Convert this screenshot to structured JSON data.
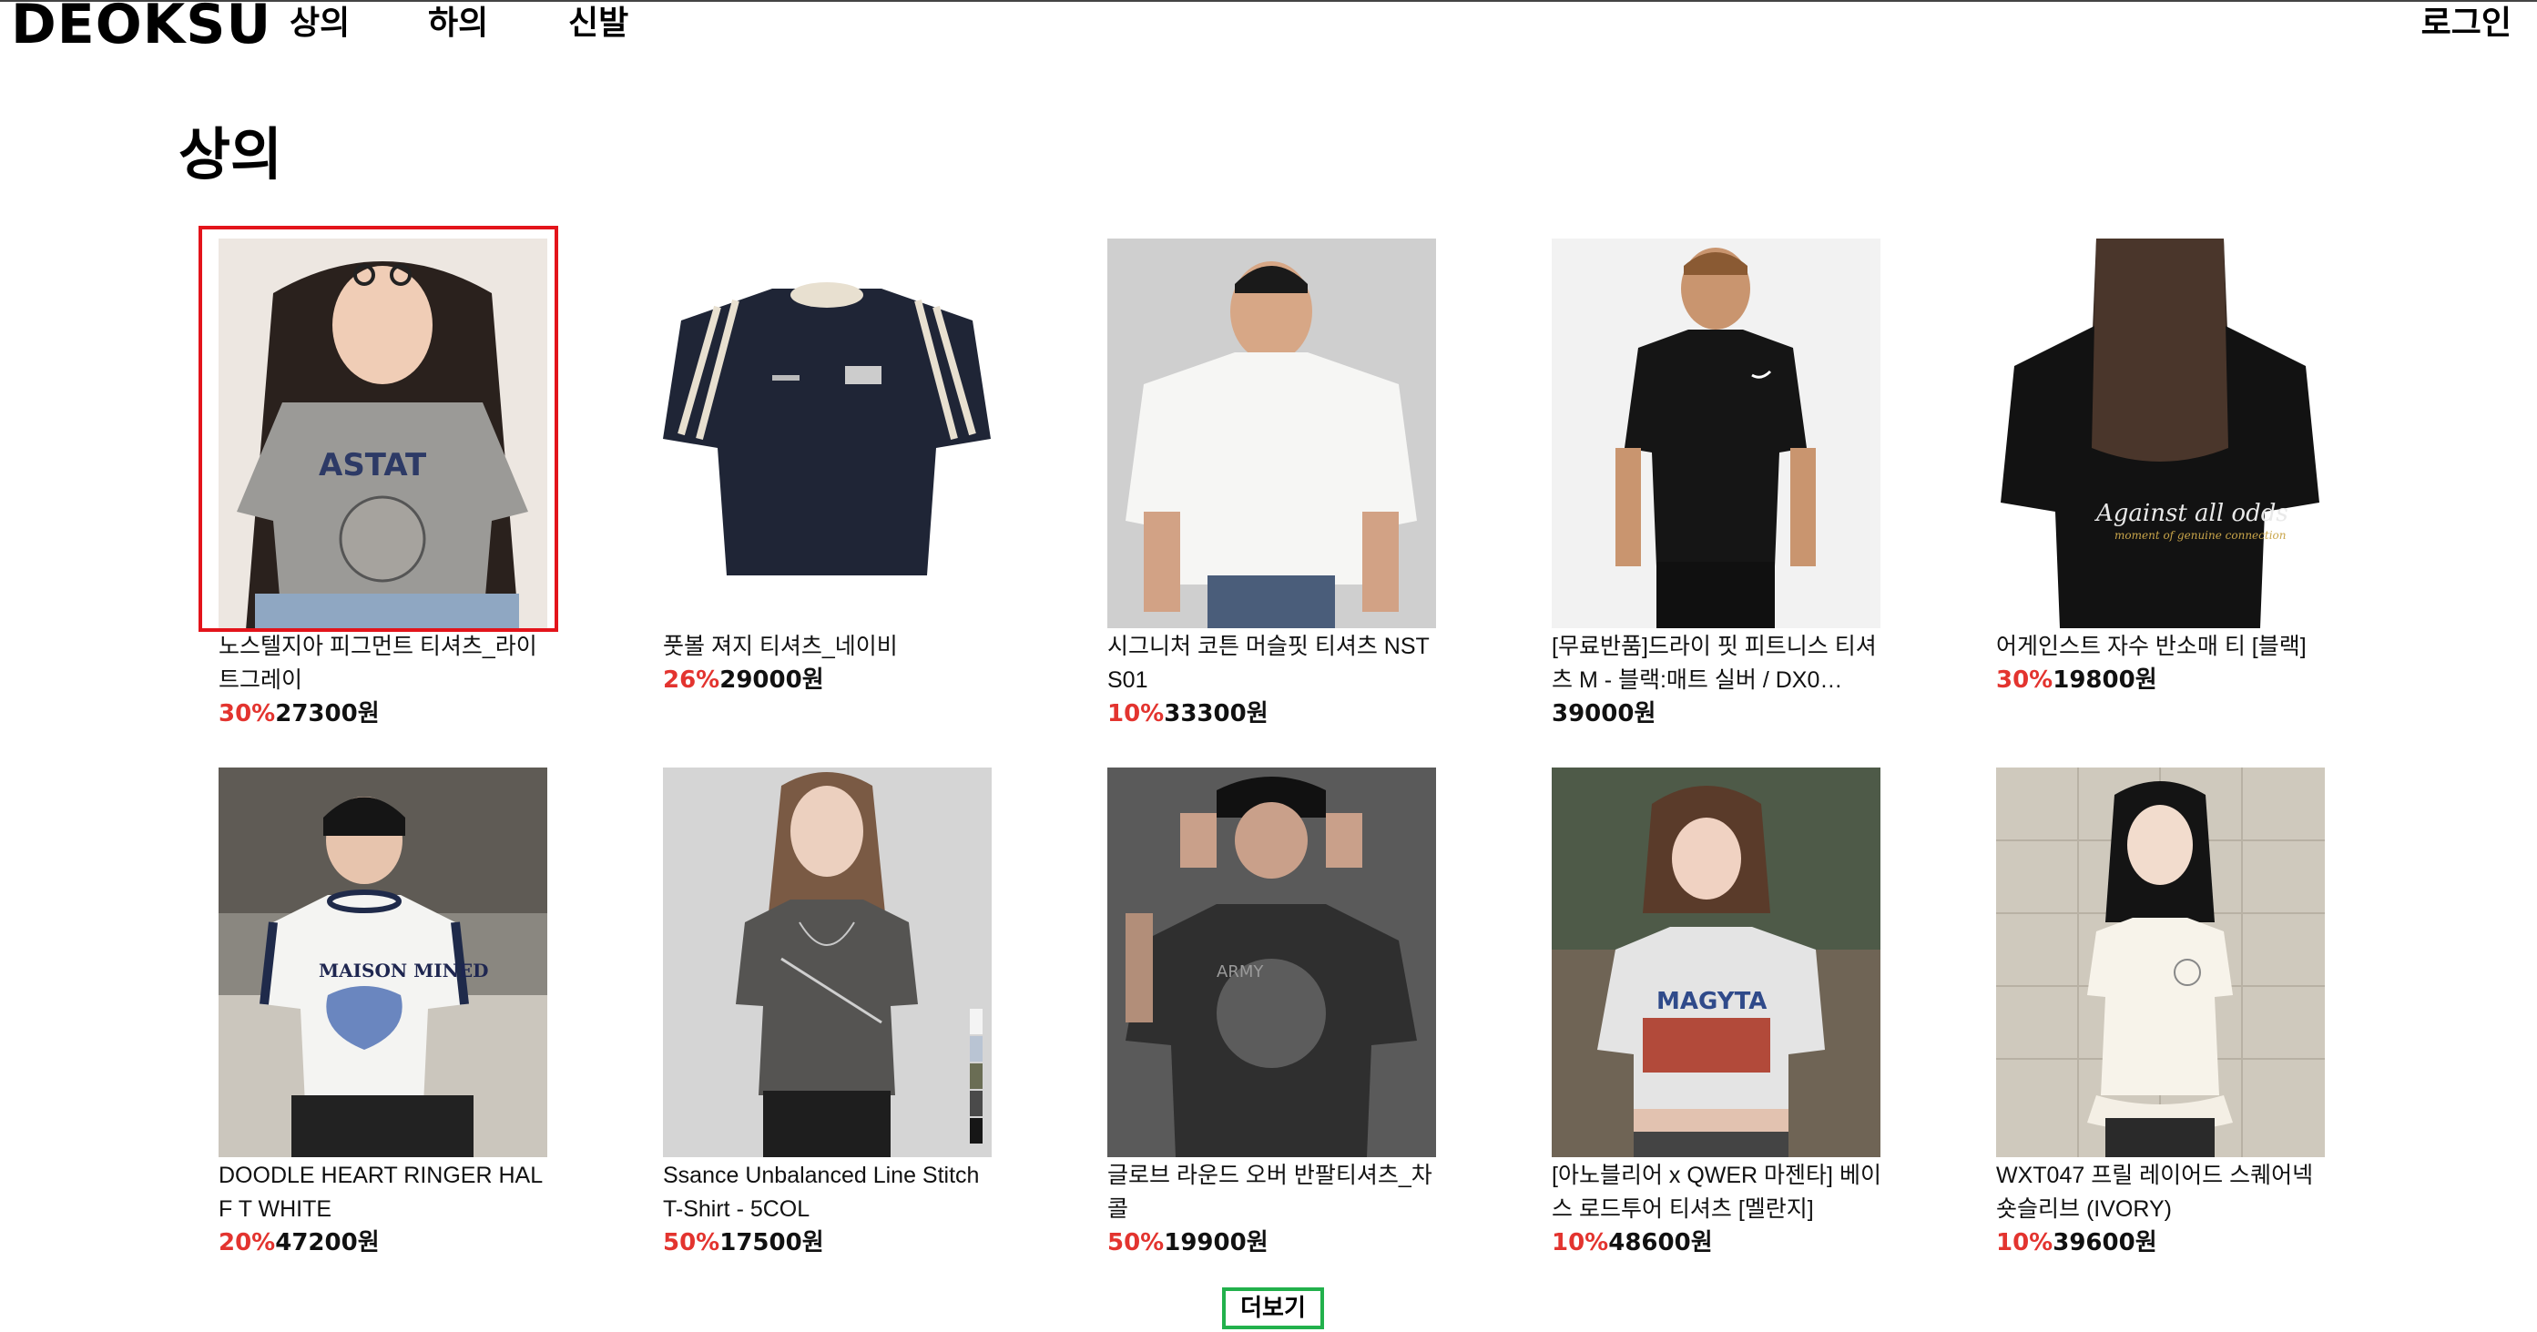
{
  "header": {
    "logo": "DEOKSU",
    "nav": [
      "상의",
      "하의",
      "신발"
    ],
    "login": "로그인"
  },
  "page_title": "상의",
  "products": [
    {
      "name": "노스텔지아 피그먼트 티셔츠_라이트그레이",
      "discount": "30%",
      "price": "27300원"
    },
    {
      "name": "풋볼 져지 티셔츠_네이비",
      "discount": "26%",
      "price": "29000원"
    },
    {
      "name": "시그니처 코튼 머슬핏 티셔츠 NSTS01",
      "discount": "10%",
      "price": "33300원"
    },
    {
      "name": "[무료반품]드라이 핏 피트니스 티셔츠 M - 블랙:매트 실버 / DX0…",
      "discount": "",
      "price": "39000원"
    },
    {
      "name": "어게인스트 자수 반소매 티 [블랙]",
      "discount": "30%",
      "price": "19800원"
    },
    {
      "name": "DOODLE HEART RINGER HALF T WHITE",
      "discount": "20%",
      "price": "47200원"
    },
    {
      "name": "Ssance Unbalanced Line Stitch T-Shirt - 5COL",
      "discount": "50%",
      "price": "17500원"
    },
    {
      "name": "글로브 라운드 오버 반팔티셔츠_차콜",
      "discount": "50%",
      "price": "19900원"
    },
    {
      "name": "[아노블리어 x QWER 마젠타] 베이스 로드투어 티셔츠 [멜란지]",
      "discount": "10%",
      "price": "48600원"
    },
    {
      "name": "WXT047 프릴 레이어드 스퀘어넥 숏슬리브 (IVORY)",
      "discount": "10%",
      "price": "39600원"
    }
  ],
  "more_button": "더보기",
  "colors": {
    "discount": "#e3342f",
    "selected_outline": "#e3141b",
    "more_button_border": "#22b14c"
  }
}
